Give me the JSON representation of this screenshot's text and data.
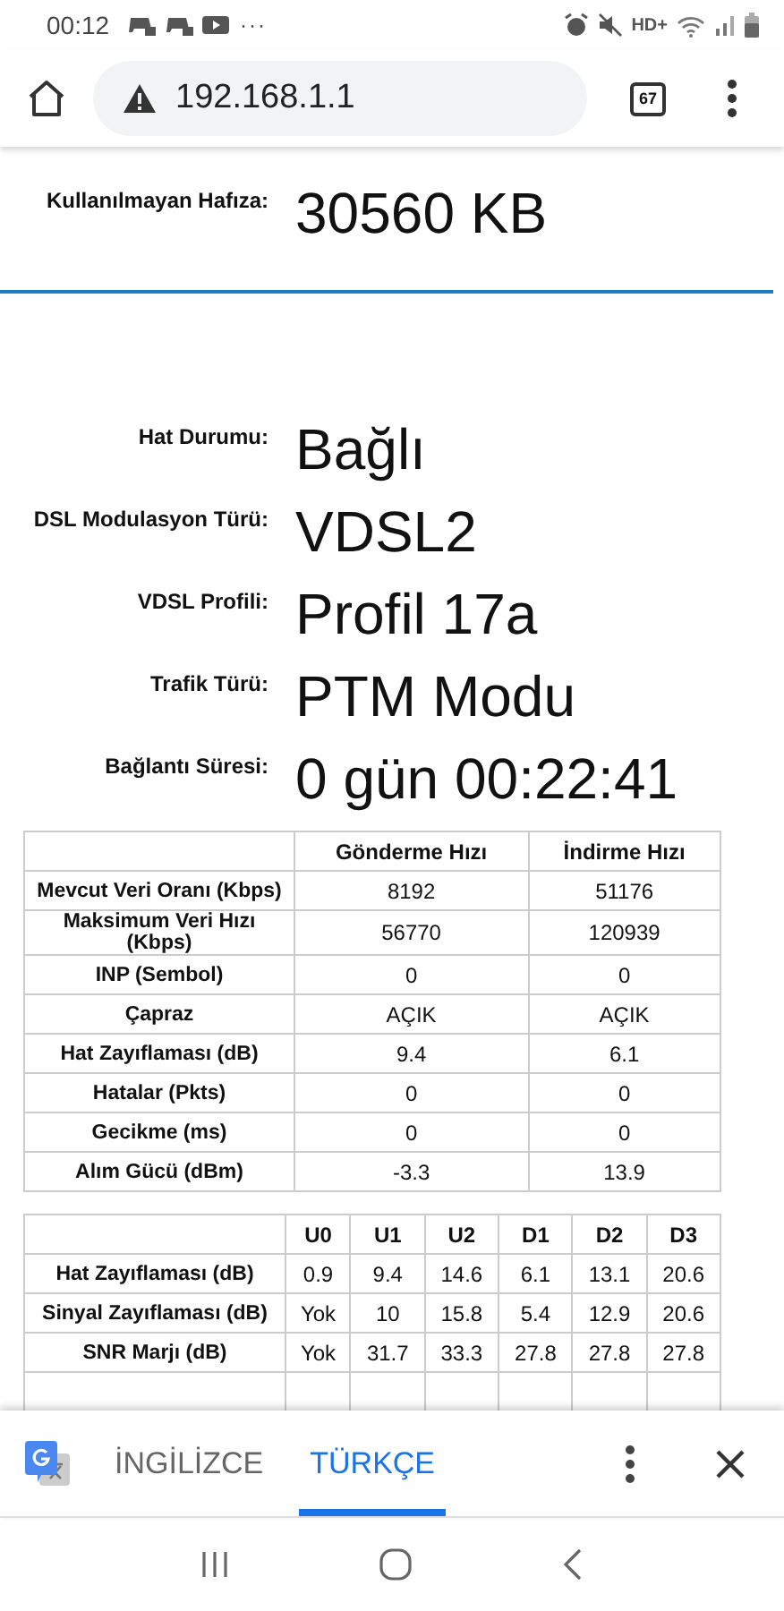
{
  "status_bar": {
    "time": "00:12",
    "more": "···",
    "network": "HD+"
  },
  "browser": {
    "url": "192.168.1.1",
    "tab_count": "67"
  },
  "info_top": [
    {
      "label": "Kullanılmayan Hafıza:",
      "value": "30560 KB"
    }
  ],
  "info_rows": [
    {
      "label": "Hat Durumu:",
      "value": "Bağlı"
    },
    {
      "label": "DSL Modulasyon Türü:",
      "value": "VDSL2"
    },
    {
      "label": "VDSL Profili:",
      "value": "Profil 17a"
    },
    {
      "label": "Trafik Türü:",
      "value": "PTM Modu"
    },
    {
      "label": "Bağlantı Süresi:",
      "value": "0 gün 00:22:41"
    }
  ],
  "rate_table": {
    "columns": [
      "Gönderme Hızı",
      "İndirme Hızı"
    ],
    "rows": [
      {
        "label": "Mevcut Veri Oranı (Kbps)",
        "cells": [
          "8192",
          "51176"
        ]
      },
      {
        "label": "Maksimum Veri Hızı (Kbps)",
        "cells": [
          "56770",
          "120939"
        ]
      },
      {
        "label": "INP (Sembol)",
        "cells": [
          "0",
          "0"
        ]
      },
      {
        "label": "Çapraz",
        "cells": [
          "AÇIK",
          "AÇIK"
        ]
      },
      {
        "label": "Hat Zayıflaması (dB)",
        "cells": [
          "9.4",
          "6.1"
        ]
      },
      {
        "label": "Hatalar (Pkts)",
        "cells": [
          "0",
          "0"
        ]
      },
      {
        "label": "Gecikme (ms)",
        "cells": [
          "0",
          "0"
        ]
      },
      {
        "label": "Alım Gücü (dBm)",
        "cells": [
          "-3.3",
          "13.9"
        ]
      }
    ]
  },
  "band_table": {
    "columns": [
      "U0",
      "U1",
      "U2",
      "D1",
      "D2",
      "D3"
    ],
    "rows": [
      {
        "label": "Hat Zayıflaması (dB)",
        "cells": [
          "0.9",
          "9.4",
          "14.6",
          "6.1",
          "13.1",
          "20.6"
        ]
      },
      {
        "label": "Sinyal Zayıflaması (dB)",
        "cells": [
          "Yok",
          "10",
          "15.8",
          "5.4",
          "12.9",
          "20.6"
        ]
      },
      {
        "label": "SNR Marjı (dB)",
        "cells": [
          "Yok",
          "31.7",
          "33.3",
          "27.8",
          "27.8",
          "27.8"
        ]
      }
    ]
  },
  "translate_bar": {
    "languages": [
      {
        "label": "İNGİLİZCE",
        "selected": false
      },
      {
        "label": "TÜRKÇE",
        "selected": true
      }
    ]
  }
}
